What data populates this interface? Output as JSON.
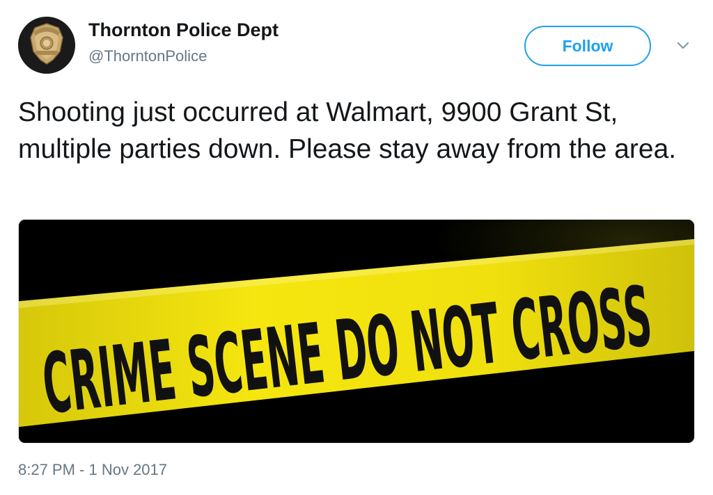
{
  "tweet": {
    "author": {
      "display_name": "Thornton Police Dept",
      "handle": "@ThorntonPolice",
      "avatar_icon": "police-badge-icon"
    },
    "follow_label": "Follow",
    "text": "Shooting just occurred at Walmart, 9900 Grant St, multiple parties down. Please stay away from the area.",
    "media": {
      "tape_text": "CRIME SCENE DO NOT CROSS",
      "tape_color": "#f5e60f"
    },
    "timestamp": "8:27 PM - 1 Nov 2017"
  },
  "colors": {
    "accent": "#1da1f2",
    "secondary_text": "#657786",
    "primary_text": "#14171a"
  }
}
